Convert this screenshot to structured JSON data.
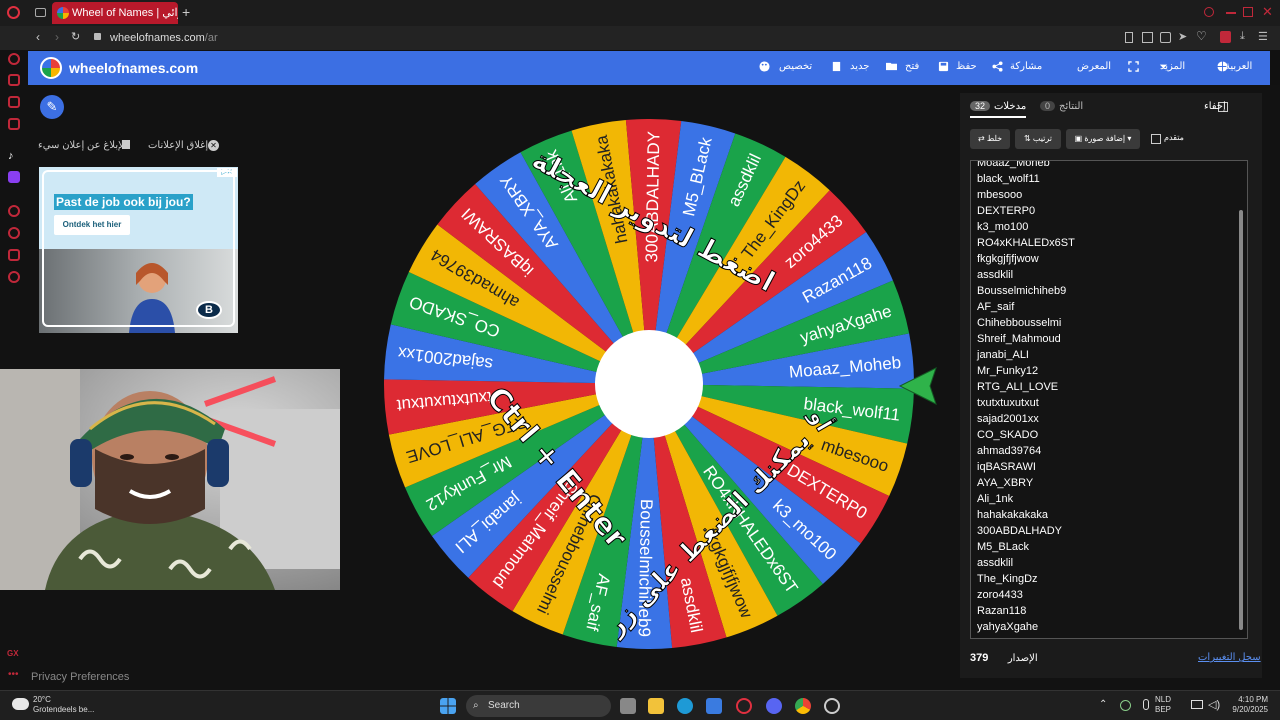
{
  "browser": {
    "tab_title": "Wheel of Names | عشوائي",
    "add_tab": "+",
    "url_host": "wheelofnames.com",
    "url_path": "/ar"
  },
  "header": {
    "site_name": "wheelofnames.com",
    "nav": {
      "customize": "تخصيص",
      "new": "جديد",
      "open": "فتح",
      "save": "حفظ",
      "share": "مشاركة",
      "gallery": "المعرض",
      "more": "المزيد",
      "language": "العربية"
    }
  },
  "ad_panel": {
    "close_ads": "إغلاق الإعلانات",
    "report_ad": "الإبلاغ عن إعلان سيء",
    "ad_headline": "Past de job ook bij jou?",
    "ad_button": "Ontdek het hier"
  },
  "wheel": {
    "center_text_1": "اضغط لتدوير العجلة",
    "center_text_2": "أو",
    "center_text_3": "يمكنك الضغط على زر",
    "shortcut": "Ctrl + Enter",
    "segment_colors": [
      "#3a73e6",
      "#1aa34a",
      "#f2b705",
      "#dd2a33"
    ]
  },
  "right_panel": {
    "hide_label": "إخفاء",
    "tab_entries_label": "مدخلات",
    "tab_entries_count": "32",
    "tab_results_label": "النتائج",
    "tab_results_count": "0",
    "shuffle": "خلط",
    "sort": "ترتيب",
    "add_image": "إضافة صورة",
    "advanced": "متقدم",
    "entries": [
      "Moaaz_Moheb",
      "black_wolf11",
      "mbesooo",
      "DEXTERP0",
      "k3_mo100",
      "RO4xKHALEDx6ST",
      "fkgkgjfjfjwow",
      "assdklil",
      "Bousselmichiheb9",
      "AF_saif",
      "Chihebbousselmi",
      "Shreif_Mahmoud",
      "janabi_ALI",
      "Mr_Funky12",
      "RTG_ALI_LOVE",
      "txutxtuxutxut",
      "sajad2001xx",
      "CO_SKADO",
      "ahmad39764",
      "iqBASRAWI",
      "AYA_XBRY",
      "Ali_1nk",
      "hahakakakaka",
      "300ABDALHADY",
      "M5_BLack",
      "assdklil",
      "The_KingDz",
      "zoro4433",
      "Razan118",
      "yahyaXgahe"
    ],
    "version_label": "الإصدار",
    "version_number": "379",
    "changelog": "سجل التغييرات"
  },
  "footer": {
    "privacy": "Privacy Preferences"
  },
  "taskbar": {
    "weather_temp": "20°C",
    "weather_desc": "Grotendeels be...",
    "search": "Search",
    "lang_1": "NLD",
    "lang_2": "BEP",
    "time": "4:10 PM",
    "date": "9/20/2025"
  }
}
